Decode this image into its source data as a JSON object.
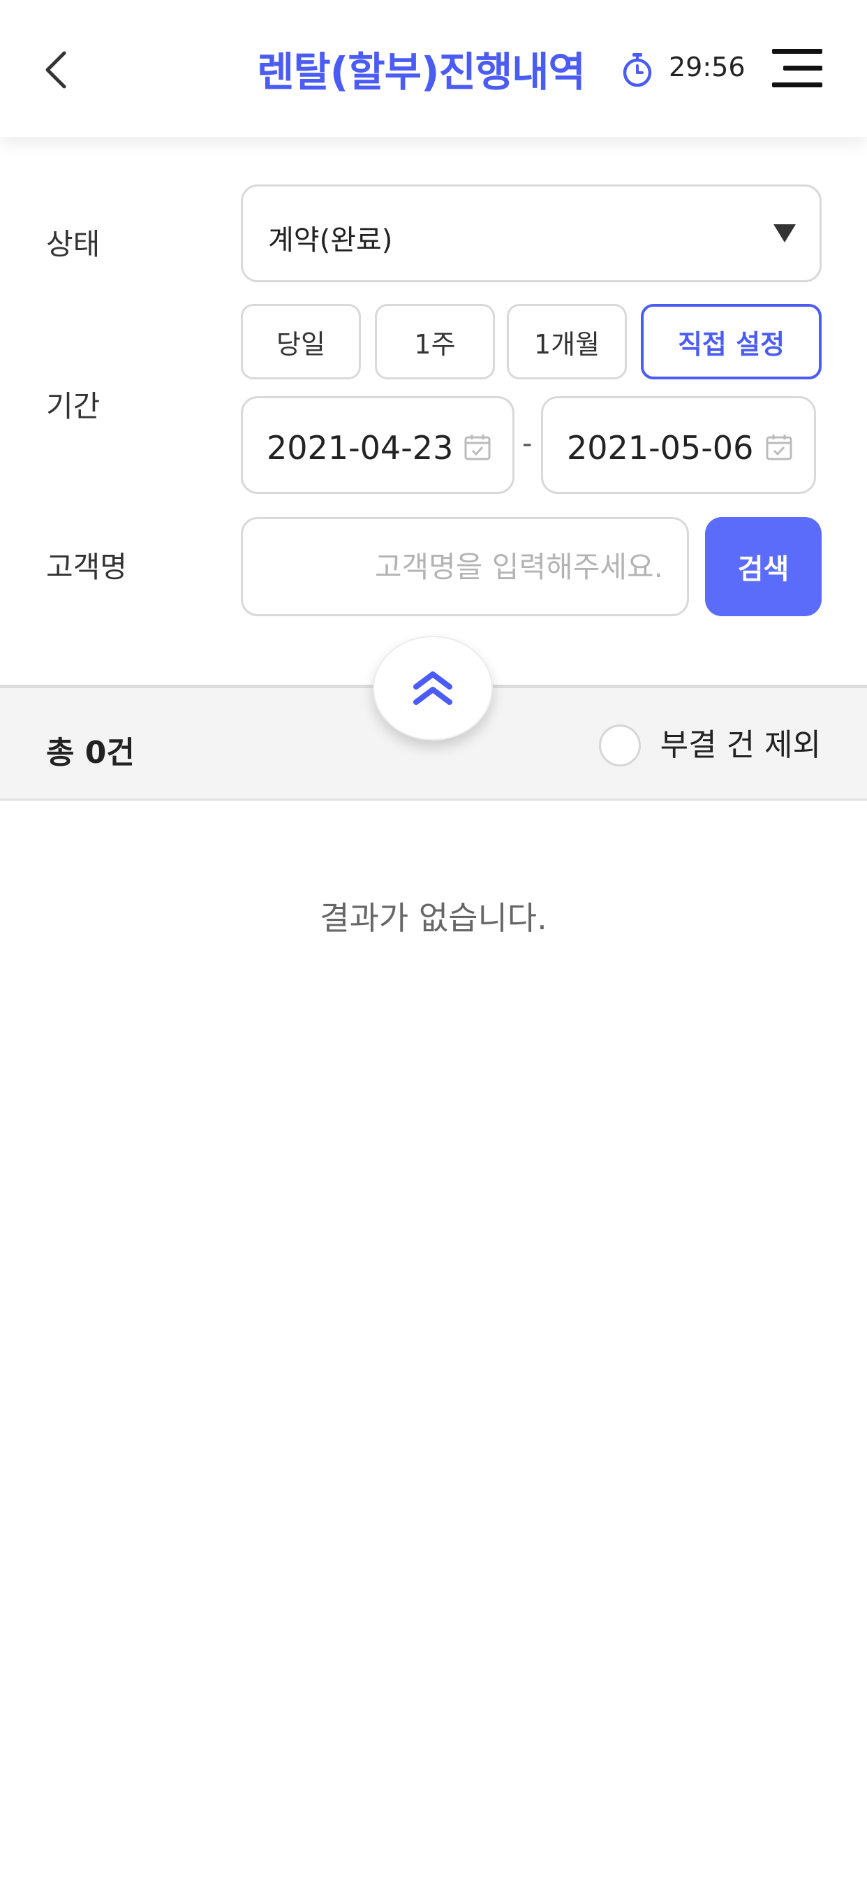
{
  "header": {
    "title": "렌탈(할부)진행내역",
    "timer": "29:56",
    "back_icon": "chevron-left-icon",
    "timer_icon": "stopwatch-icon",
    "menu_icon": "hamburger-menu-icon"
  },
  "filters": {
    "status": {
      "label": "상태",
      "selected": "계약(완료)"
    },
    "period": {
      "label": "기간",
      "options": [
        "당일",
        "1주",
        "1개월",
        "직접 설정"
      ],
      "active": "직접 설정",
      "start_date": "2021-04-23",
      "separator": "-",
      "end_date": "2021-05-06"
    },
    "customer": {
      "label": "고객명",
      "placeholder": "고객명을 입력해주세요.",
      "value": "",
      "search_label": "검색"
    }
  },
  "summary": {
    "total": "총 0건",
    "exclude_label": "부결 건 제외",
    "exclude_checked": false
  },
  "results": {
    "empty_message": "결과가 없습니다."
  },
  "colors": {
    "accent": "#4b5cf5",
    "search_button": "#5b6cfa",
    "border": "#d9d9d9",
    "summary_bg": "#f4f4f4"
  }
}
